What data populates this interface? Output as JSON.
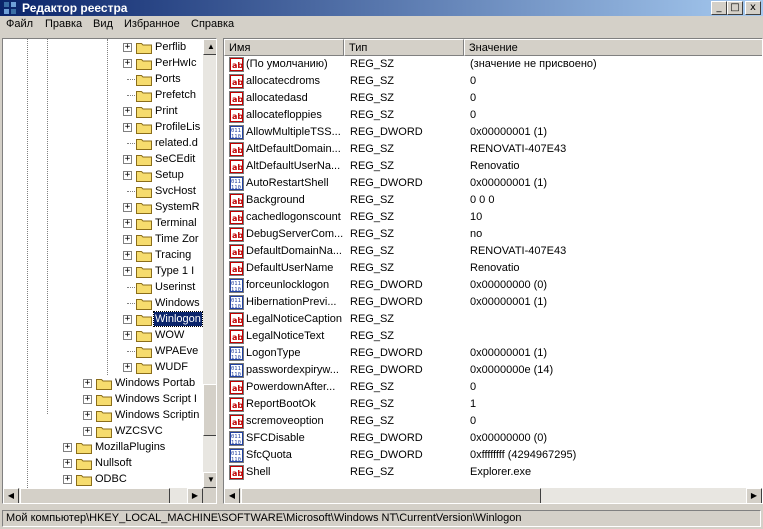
{
  "window": {
    "title": "Редактор реестра",
    "min": "_",
    "max": "□",
    "close": "x"
  },
  "menu": [
    "Файл",
    "Правка",
    "Вид",
    "Избранное",
    "Справка"
  ],
  "tree": {
    "items": [
      {
        "label": "Perflib",
        "level": 2,
        "expander": "+"
      },
      {
        "label": "PerHwIc",
        "level": 2,
        "expander": "+"
      },
      {
        "label": "Ports",
        "level": 2,
        "expander": ""
      },
      {
        "label": "Prefetch",
        "level": 2,
        "expander": ""
      },
      {
        "label": "Print",
        "level": 2,
        "expander": "+"
      },
      {
        "label": "ProfileLis",
        "level": 2,
        "expander": "+"
      },
      {
        "label": "related.d",
        "level": 2,
        "expander": ""
      },
      {
        "label": "SeCEdit",
        "level": 2,
        "expander": "+"
      },
      {
        "label": "Setup",
        "level": 2,
        "expander": "+"
      },
      {
        "label": "SvcHost",
        "level": 2,
        "expander": ""
      },
      {
        "label": "SystemR",
        "level": 2,
        "expander": "+"
      },
      {
        "label": "Terminal",
        "level": 2,
        "expander": "+"
      },
      {
        "label": "Time Zor",
        "level": 2,
        "expander": "+"
      },
      {
        "label": "Tracing",
        "level": 2,
        "expander": "+"
      },
      {
        "label": "Type 1 I",
        "level": 2,
        "expander": "+"
      },
      {
        "label": "Userinst",
        "level": 2,
        "expander": ""
      },
      {
        "label": "Windows",
        "level": 2,
        "expander": ""
      },
      {
        "label": "Winlogon",
        "level": 2,
        "expander": "+",
        "selected": true
      },
      {
        "label": "WOW",
        "level": 2,
        "expander": "+"
      },
      {
        "label": "WPAEve",
        "level": 2,
        "expander": ""
      },
      {
        "label": "WUDF",
        "level": 2,
        "expander": "+"
      },
      {
        "label": "Windows Portab",
        "level": 1,
        "expander": "+"
      },
      {
        "label": "Windows Script I",
        "level": 1,
        "expander": "+"
      },
      {
        "label": "Windows Scriptin",
        "level": 1,
        "expander": "+"
      },
      {
        "label": "WZCSVC",
        "level": 1,
        "expander": "+"
      },
      {
        "label": "MozillaPlugins",
        "level": 0,
        "expander": "+"
      },
      {
        "label": "Nullsoft",
        "level": 0,
        "expander": "+"
      },
      {
        "label": "ODBC",
        "level": 0,
        "expander": "+"
      }
    ]
  },
  "list": {
    "headers": [
      "Имя",
      "Тип",
      "Значение"
    ],
    "rows": [
      {
        "icon": "string",
        "name": "(По умолчанию)",
        "type": "REG_SZ",
        "value": "(значение не присвоено)"
      },
      {
        "icon": "string",
        "name": "allocatecdroms",
        "type": "REG_SZ",
        "value": "0"
      },
      {
        "icon": "string",
        "name": "allocatedasd",
        "type": "REG_SZ",
        "value": "0"
      },
      {
        "icon": "string",
        "name": "allocatefloppies",
        "type": "REG_SZ",
        "value": "0"
      },
      {
        "icon": "dword",
        "name": "AllowMultipleTSS...",
        "type": "REG_DWORD",
        "value": "0x00000001 (1)"
      },
      {
        "icon": "string",
        "name": "AltDefaultDomain...",
        "type": "REG_SZ",
        "value": "RENOVATI-407E43"
      },
      {
        "icon": "string",
        "name": "AltDefaultUserNa...",
        "type": "REG_SZ",
        "value": "Renovatio"
      },
      {
        "icon": "dword",
        "name": "AutoRestartShell",
        "type": "REG_DWORD",
        "value": "0x00000001 (1)"
      },
      {
        "icon": "string",
        "name": "Background",
        "type": "REG_SZ",
        "value": "0 0 0"
      },
      {
        "icon": "string",
        "name": "cachedlogonscount",
        "type": "REG_SZ",
        "value": "10"
      },
      {
        "icon": "string",
        "name": "DebugServerCom...",
        "type": "REG_SZ",
        "value": "no"
      },
      {
        "icon": "string",
        "name": "DefaultDomainNa...",
        "type": "REG_SZ",
        "value": "RENOVATI-407E43"
      },
      {
        "icon": "string",
        "name": "DefaultUserName",
        "type": "REG_SZ",
        "value": "Renovatio"
      },
      {
        "icon": "dword",
        "name": "forceunlocklogon",
        "type": "REG_DWORD",
        "value": "0x00000000 (0)"
      },
      {
        "icon": "dword",
        "name": "HibernationPrevi...",
        "type": "REG_DWORD",
        "value": "0x00000001 (1)"
      },
      {
        "icon": "string",
        "name": "LegalNoticeCaption",
        "type": "REG_SZ",
        "value": ""
      },
      {
        "icon": "string",
        "name": "LegalNoticeText",
        "type": "REG_SZ",
        "value": ""
      },
      {
        "icon": "dword",
        "name": "LogonType",
        "type": "REG_DWORD",
        "value": "0x00000001 (1)"
      },
      {
        "icon": "dword",
        "name": "passwordexpiryw...",
        "type": "REG_DWORD",
        "value": "0x0000000e (14)"
      },
      {
        "icon": "string",
        "name": "PowerdownAfter...",
        "type": "REG_SZ",
        "value": "0"
      },
      {
        "icon": "string",
        "name": "ReportBootOk",
        "type": "REG_SZ",
        "value": "1"
      },
      {
        "icon": "string",
        "name": "scremoveoption",
        "type": "REG_SZ",
        "value": "0"
      },
      {
        "icon": "dword",
        "name": "SFCDisable",
        "type": "REG_DWORD",
        "value": "0x00000000 (0)"
      },
      {
        "icon": "dword",
        "name": "SfcQuota",
        "type": "REG_DWORD",
        "value": "0xffffffff (4294967295)"
      },
      {
        "icon": "string",
        "name": "Shell",
        "type": "REG_SZ",
        "value": "Explorer.exe"
      }
    ]
  },
  "status": {
    "path": "Мой компьютер\\HKEY_LOCAL_MACHINE\\SOFTWARE\\Microsoft\\Windows NT\\CurrentVersion\\Winlogon"
  },
  "colors": {
    "titlebar_start": "#0a246a",
    "titlebar_end": "#a6caf0",
    "face": "#d4d0c8",
    "selection": "#0a246a"
  }
}
